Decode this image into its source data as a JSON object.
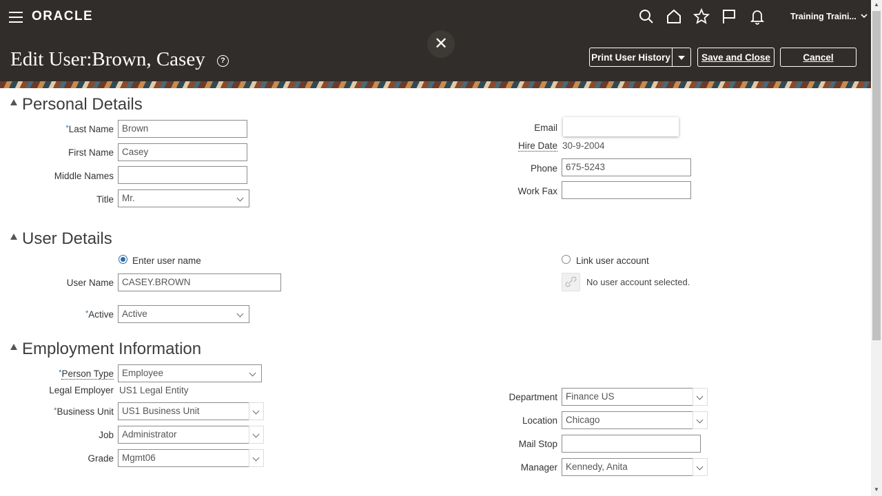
{
  "header": {
    "logo": "ORACLE",
    "user_menu": "Training Traini...",
    "page_title": "Edit User:Brown, Casey",
    "help": "?",
    "close": "✕",
    "buttons": {
      "print_history": "Print User History",
      "save_close": "Save and Close",
      "cancel": "Cancel"
    },
    "icons": [
      "search-icon",
      "home-icon",
      "favorites-star-icon",
      "flag-icon",
      "notifications-bell-icon"
    ]
  },
  "personal": {
    "title": "Personal Details",
    "last_name_label": "Last Name",
    "last_name": "Brown",
    "first_name_label": "First Name",
    "first_name": "Casey",
    "middle_names_label": "Middle Names",
    "middle_names": "",
    "title_label": "Title",
    "title_value": "Mr.",
    "email_label": "Email",
    "email": "",
    "hire_date_label": "Hire Date",
    "hire_date": "30-9-2004",
    "phone_label": "Phone",
    "phone": "675-5243",
    "work_fax_label": "Work Fax",
    "work_fax": ""
  },
  "user": {
    "title": "User Details",
    "enter_username_option": "Enter user name",
    "link_account_option": "Link user account",
    "username_label": "User Name",
    "username": "CASEY.BROWN",
    "no_account": "No user account selected.",
    "active_label": "Active",
    "active_value": "Active"
  },
  "employment": {
    "title": "Employment Information",
    "person_type_label": "Person Type",
    "person_type": "Employee",
    "legal_employer_label": "Legal Employer",
    "legal_employer": "US1 Legal Entity",
    "business_unit_label": "Business Unit",
    "business_unit": "US1 Business Unit",
    "job_label": "Job",
    "job": "Administrator",
    "grade_label": "Grade",
    "grade": "Mgmt06",
    "department_label": "Department",
    "department": "Finance US",
    "location_label": "Location",
    "location": "Chicago",
    "mail_stop_label": "Mail Stop",
    "mail_stop": "",
    "manager_label": "Manager",
    "manager": "Kennedy, Anita"
  },
  "colors": {
    "header_bg": "#312d2a",
    "required_marker": "#2a6da9",
    "radio_selected": "#2a6da9"
  }
}
